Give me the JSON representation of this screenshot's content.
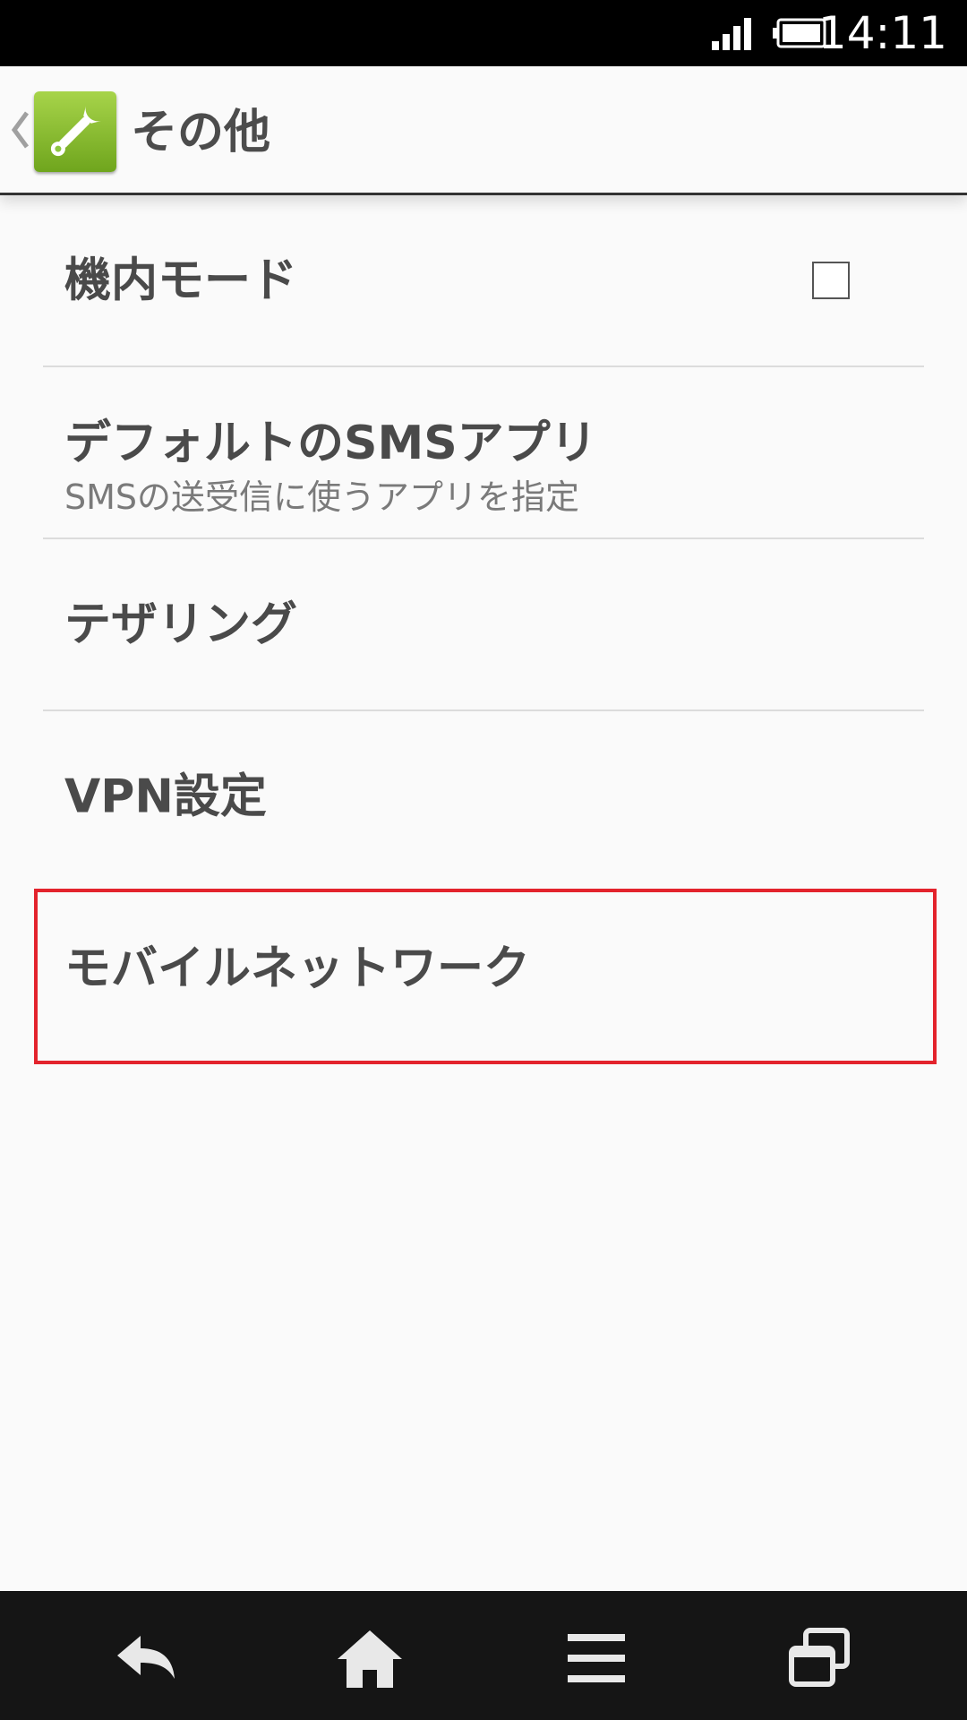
{
  "status_bar": {
    "time": "14:11",
    "signal_icon": "signal-icon",
    "battery_icon": "battery-icon"
  },
  "action_bar": {
    "title": "その他",
    "up_icon": "chevron-left-icon",
    "app_icon": "wrench-icon"
  },
  "settings": {
    "items": [
      {
        "title": "機内モード",
        "summary": "",
        "checkbox": true,
        "checked": false
      },
      {
        "title": "デフォルトのSMSアプリ",
        "summary": "SMSの送受信に使うアプリを指定"
      },
      {
        "title": "テザリング",
        "summary": ""
      },
      {
        "title": "VPN設定",
        "summary": ""
      },
      {
        "title": "モバイルネットワーク",
        "summary": "",
        "highlighted": true
      }
    ]
  },
  "colors": {
    "highlight": "#e3232c",
    "app_icon_green": "#8cc63f",
    "status_bar_bg": "#000000",
    "nav_bar_bg": "#151515"
  },
  "nav_bar": {
    "back_icon": "back-icon",
    "home_icon": "home-icon",
    "menu_icon": "menu-icon",
    "recent_icon": "recent-apps-icon"
  }
}
